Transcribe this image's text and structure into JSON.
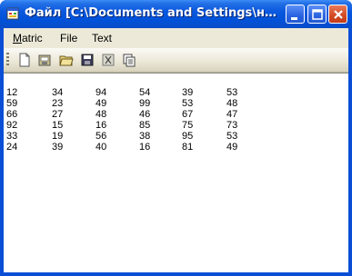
{
  "window": {
    "title": "Файл [C:\\Documents and Settings\\никифоров\\Мои документы\\matrix.txt]"
  },
  "titlebar_buttons": {
    "minimize_icon": "minimize-icon",
    "maximize_icon": "maximize-icon",
    "close_icon": "close-icon"
  },
  "menu": {
    "matric_first": "M",
    "matric_rest": "atric",
    "file": "File",
    "text": "Text"
  },
  "toolbar": {
    "icons": [
      "new-file-icon",
      "open-icon",
      "open-folder-icon",
      "save-icon",
      "cut-icon",
      "copy-icon"
    ]
  },
  "matrix": {
    "rows": [
      [
        "12",
        "34",
        "94",
        "54",
        "39",
        "53"
      ],
      [
        "59",
        "23",
        "49",
        "99",
        "53",
        "48"
      ],
      [
        "66",
        "27",
        "48",
        "46",
        "67",
        "47"
      ],
      [
        "92",
        "15",
        "16",
        "85",
        "75",
        "73"
      ],
      [
        "33",
        "19",
        "56",
        "38",
        "95",
        "53"
      ],
      [
        "24",
        "39",
        "40",
        "16",
        "81",
        "49"
      ]
    ]
  },
  "colors": {
    "titlebar": "#0052d9",
    "close_button": "#d24a22",
    "menubar": "#ece9d8"
  }
}
